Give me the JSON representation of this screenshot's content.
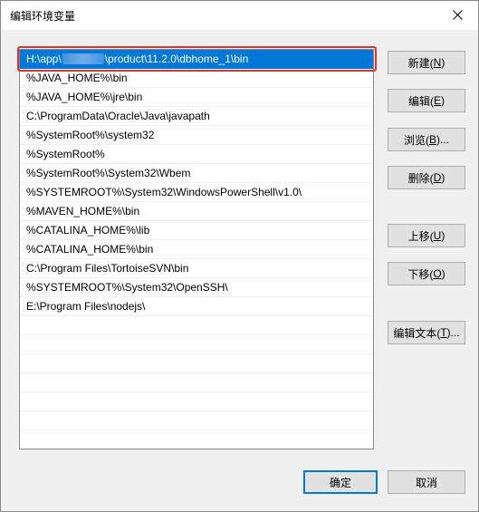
{
  "window": {
    "title": "编辑环境变量"
  },
  "list": {
    "selected_index": 0,
    "items": [
      {
        "before": "H:\\app\\",
        "after": "\\product\\11.2.0\\dbhome_1\\bin",
        "redacted": true
      },
      {
        "text": "%JAVA_HOME%\\bin"
      },
      {
        "text": "%JAVA_HOME%\\jre\\bin"
      },
      {
        "text": "C:\\ProgramData\\Oracle\\Java\\javapath"
      },
      {
        "text": "%SystemRoot%\\system32"
      },
      {
        "text": "%SystemRoot%"
      },
      {
        "text": "%SystemRoot%\\System32\\Wbem"
      },
      {
        "text": "%SYSTEMROOT%\\System32\\WindowsPowerShell\\v1.0\\"
      },
      {
        "text": "%MAVEN_HOME%\\bin"
      },
      {
        "text": "%CATALINA_HOME%\\lib"
      },
      {
        "text": "%CATALINA_HOME%\\bin"
      },
      {
        "text": "C:\\Program Files\\TortoiseSVN\\bin"
      },
      {
        "text": "%SYSTEMROOT%\\System32\\OpenSSH\\"
      },
      {
        "text": "E:\\Program Files\\nodejs\\"
      }
    ],
    "empty_rows": 7
  },
  "buttons": {
    "new": {
      "label": "新建(",
      "accel": "N",
      "suffix": ")"
    },
    "edit": {
      "label": "编辑(",
      "accel": "E",
      "suffix": ")"
    },
    "browse": {
      "label": "浏览(",
      "accel": "B",
      "suffix": ")..."
    },
    "delete": {
      "label": "删除(",
      "accel": "D",
      "suffix": ")"
    },
    "move_up": {
      "label": "上移(",
      "accel": "U",
      "suffix": ")"
    },
    "move_down": {
      "label": "下移(",
      "accel": "O",
      "suffix": ")"
    },
    "edit_text": {
      "label": "编辑文本(",
      "accel": "T",
      "suffix": ")..."
    },
    "ok": {
      "label": "确定"
    },
    "cancel": {
      "label": "取消"
    }
  },
  "colors": {
    "selection": "#0078d7",
    "highlight_box": "#e0322c",
    "default_button_border": "#0078d7"
  }
}
